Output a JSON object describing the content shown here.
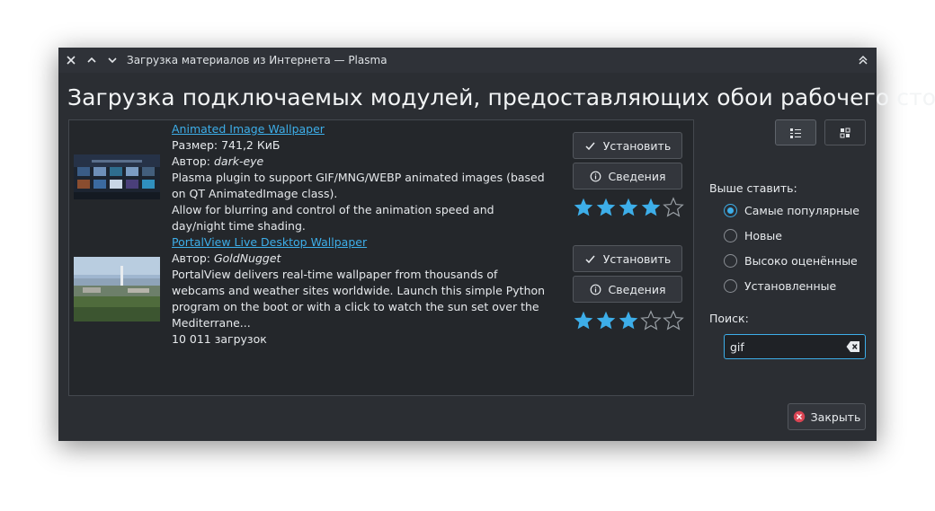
{
  "window": {
    "title": "Загрузка материалов из Интернета — Plasma",
    "heading": "Загрузка подключаемых модулей, предоставляющих обои рабочего стола"
  },
  "items": [
    {
      "title": "Animated Image Wallpaper",
      "size": "Размер: 741,2 КиБ",
      "author_prefix": "Автор: ",
      "author": "dark-eye",
      "desc_line1": "Plasma plugin to support GIF/MNG/WEBP animated images (based on QT AnimatedImage class).",
      "desc_line2": " Allow for blurring and control of the animation speed and day/night time shading.",
      "install_label": "Установить",
      "details_label": "Сведения",
      "rating": 4
    },
    {
      "title": "PortalView Live Desktop Wallpaper",
      "author_prefix": "Автор: ",
      "author": "GoldNugget",
      "desc": "PortalView delivers real-time wallpaper from thousands of webcams and weather sites worldwide. Launch this simple Python program on the boot or with a click to watch the sun set over the Mediterrane...",
      "downloads": "10 011 загрузок",
      "install_label": "Установить",
      "details_label": "Сведения",
      "rating": 3
    }
  ],
  "sidebar": {
    "sort_label": "Выше ставить:",
    "sort_options": [
      "Самые популярные",
      "Новые",
      "Высоко оценённые",
      "Установленные"
    ],
    "selected_sort": "Самые популярные",
    "search_label": "Поиск:",
    "search_value": "gif"
  },
  "close_label": "Закрыть",
  "colors": {
    "accent": "#3daee9",
    "window_bg": "#2b2e33",
    "list_bg": "#24272b",
    "close_icon": "#da4453"
  },
  "icons": {
    "window_controls": [
      "close-icon",
      "chevron-up-icon",
      "chevron-down-icon"
    ],
    "keep_above": "double-chevron-up-icon",
    "install": "checkmark-icon",
    "details": "info-icon",
    "view_modes": [
      "details-list-icon",
      "grid-icon"
    ],
    "clear": "clear-backspace-icon",
    "close": "close-circle-icon"
  }
}
